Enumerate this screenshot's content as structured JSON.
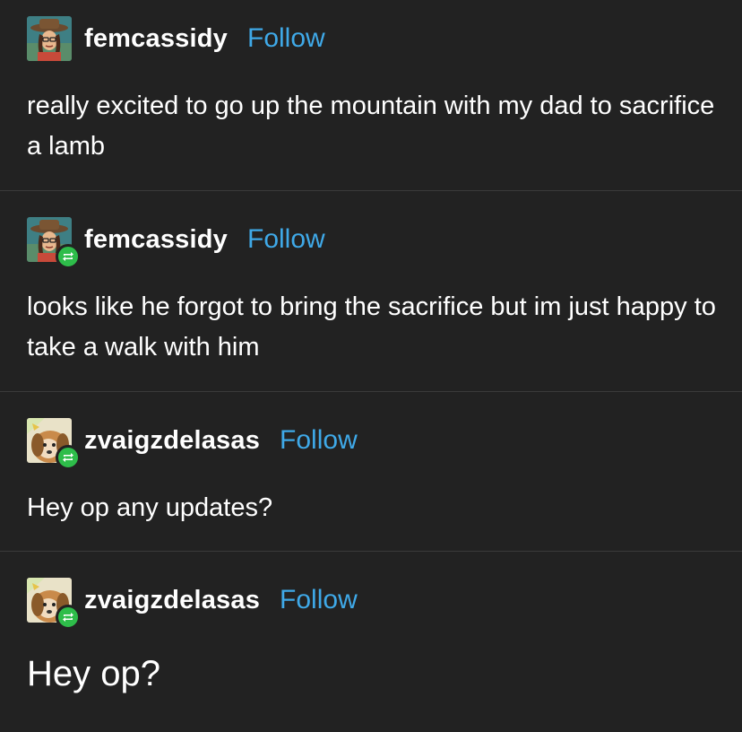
{
  "posts": [
    {
      "username": "femcassidy",
      "follow_label": "Follow",
      "text": "really excited to go up the mountain with my dad to sacrifice a lamb",
      "reblogged": false,
      "avatar": "cowboy-avatar"
    },
    {
      "username": "femcassidy",
      "follow_label": "Follow",
      "text": "looks like he forgot to bring the sacrifice but im just happy to take a walk with him",
      "reblogged": true,
      "avatar": "cowboy-avatar"
    },
    {
      "username": "zvaigzdelasas",
      "follow_label": "Follow",
      "text": "Hey op any updates?",
      "reblogged": true,
      "avatar": "dog-avatar"
    },
    {
      "username": "zvaigzdelasas",
      "follow_label": "Follow",
      "text": "Hey op?",
      "reblogged": true,
      "avatar": "dog-avatar"
    }
  ],
  "colors": {
    "background": "#222222",
    "follow": "#3fa9e8",
    "reblog_badge": "#2ebd4a",
    "divider": "#3a3a3a"
  }
}
